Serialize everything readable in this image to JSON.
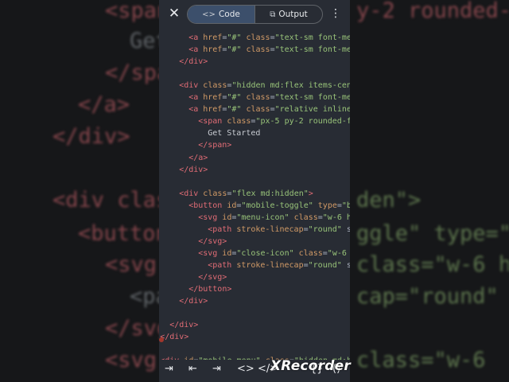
{
  "background": [
    {
      "cls": "t",
      "text": "<span"
    },
    {
      "cls": "p",
      "text": "Get"
    },
    {
      "cls": "t",
      "text": "</spa"
    },
    {
      "cls": "t",
      "text": "</a>"
    },
    {
      "cls": "t",
      "text": "</div>"
    },
    {
      "cls": "t",
      "text": "<div clas"
    },
    {
      "cls": "t",
      "text": "<button"
    },
    {
      "cls": "t",
      "text": "<svg"
    },
    {
      "cls": "p",
      "text": "<pa"
    },
    {
      "cls": "t",
      "text": "</svg"
    },
    {
      "cls": "t",
      "text": "<svg"
    },
    {
      "cls": "t",
      "text": "y-2 rounded-f"
    },
    {
      "cls": "s",
      "text": "den\">"
    },
    {
      "cls": "s",
      "text": "ggle\" type=\"b"
    },
    {
      "cls": "s",
      "text": "class=\"w-6 h"
    },
    {
      "cls": "s",
      "text": "cap=\"round\" s"
    },
    {
      "cls": "s",
      "text": "class=\"w-6"
    }
  ],
  "toolbar": {
    "close_icon": "close-icon",
    "tabs": [
      {
        "label": "Code",
        "icon": "<>",
        "active": true
      },
      {
        "label": "Output",
        "icon": "⧉",
        "active": false
      }
    ],
    "more_icon": "more-vert-icon"
  },
  "code_lines": [
    {
      "indent": 3,
      "segs": [
        [
          "t",
          "<a "
        ],
        [
          "a",
          "href"
        ],
        [
          "p",
          "="
        ],
        [
          "s",
          "\"#\""
        ],
        [
          "p",
          " "
        ],
        [
          "a",
          "class"
        ],
        [
          "p",
          "="
        ],
        [
          "s",
          "\"text-sm font-me"
        ]
      ]
    },
    {
      "indent": 3,
      "segs": [
        [
          "t",
          "<a "
        ],
        [
          "a",
          "href"
        ],
        [
          "p",
          "="
        ],
        [
          "s",
          "\"#\""
        ],
        [
          "p",
          " "
        ],
        [
          "a",
          "class"
        ],
        [
          "p",
          "="
        ],
        [
          "s",
          "\"text-sm font-me"
        ]
      ]
    },
    {
      "indent": 2,
      "segs": [
        [
          "t",
          "</div>"
        ]
      ]
    },
    {
      "indent": 0,
      "segs": []
    },
    {
      "indent": 2,
      "segs": [
        [
          "t",
          "<div "
        ],
        [
          "a",
          "class"
        ],
        [
          "p",
          "="
        ],
        [
          "s",
          "\"hidden md:flex items-cen"
        ]
      ]
    },
    {
      "indent": 3,
      "segs": [
        [
          "t",
          "<a "
        ],
        [
          "a",
          "href"
        ],
        [
          "p",
          "="
        ],
        [
          "s",
          "\"#\""
        ],
        [
          "p",
          " "
        ],
        [
          "a",
          "class"
        ],
        [
          "p",
          "="
        ],
        [
          "s",
          "\"text-sm font-me"
        ]
      ]
    },
    {
      "indent": 3,
      "segs": [
        [
          "t",
          "<a "
        ],
        [
          "a",
          "href"
        ],
        [
          "p",
          "="
        ],
        [
          "s",
          "\"#\""
        ],
        [
          "p",
          " "
        ],
        [
          "a",
          "class"
        ],
        [
          "p",
          "="
        ],
        [
          "s",
          "\"relative inline"
        ]
      ]
    },
    {
      "indent": 4,
      "segs": [
        [
          "t",
          "<span "
        ],
        [
          "a",
          "class"
        ],
        [
          "p",
          "="
        ],
        [
          "s",
          "\"px-5 py-2 rounded-f"
        ]
      ]
    },
    {
      "indent": 5,
      "segs": [
        [
          "x",
          "Get Started"
        ]
      ]
    },
    {
      "indent": 4,
      "segs": [
        [
          "t",
          "</span>"
        ]
      ]
    },
    {
      "indent": 3,
      "segs": [
        [
          "t",
          "</a>"
        ]
      ]
    },
    {
      "indent": 2,
      "segs": [
        [
          "t",
          "</div>"
        ]
      ]
    },
    {
      "indent": 0,
      "segs": []
    },
    {
      "indent": 2,
      "segs": [
        [
          "t",
          "<div "
        ],
        [
          "a",
          "class"
        ],
        [
          "p",
          "="
        ],
        [
          "s",
          "\"flex md:hidden\""
        ],
        [
          "t",
          ">"
        ]
      ]
    },
    {
      "indent": 3,
      "segs": [
        [
          "t",
          "<button "
        ],
        [
          "a",
          "id"
        ],
        [
          "p",
          "="
        ],
        [
          "s",
          "\"mobile-toggle\""
        ],
        [
          "p",
          " "
        ],
        [
          "a",
          "type"
        ],
        [
          "p",
          "="
        ],
        [
          "s",
          "\"b"
        ]
      ]
    },
    {
      "indent": 4,
      "segs": [
        [
          "t",
          "<svg "
        ],
        [
          "a",
          "id"
        ],
        [
          "p",
          "="
        ],
        [
          "s",
          "\"menu-icon\""
        ],
        [
          "p",
          " "
        ],
        [
          "a",
          "class"
        ],
        [
          "p",
          "="
        ],
        [
          "s",
          "\"w-6 h"
        ]
      ]
    },
    {
      "indent": 5,
      "segs": [
        [
          "t",
          "<path "
        ],
        [
          "a",
          "stroke-linecap"
        ],
        [
          "p",
          "="
        ],
        [
          "s",
          "\"round\""
        ],
        [
          "p",
          " s"
        ]
      ]
    },
    {
      "indent": 4,
      "segs": [
        [
          "t",
          "</svg>"
        ]
      ]
    },
    {
      "indent": 4,
      "segs": [
        [
          "t",
          "<svg "
        ],
        [
          "a",
          "id"
        ],
        [
          "p",
          "="
        ],
        [
          "s",
          "\"close-icon\""
        ],
        [
          "p",
          " "
        ],
        [
          "a",
          "class"
        ],
        [
          "p",
          "="
        ],
        [
          "s",
          "\"w-6"
        ]
      ]
    },
    {
      "indent": 5,
      "segs": [
        [
          "t",
          "<path "
        ],
        [
          "a",
          "stroke-linecap"
        ],
        [
          "p",
          "="
        ],
        [
          "s",
          "\"round\""
        ],
        [
          "p",
          " s"
        ]
      ]
    },
    {
      "indent": 4,
      "segs": [
        [
          "t",
          "</svg>"
        ]
      ]
    },
    {
      "indent": 3,
      "segs": [
        [
          "t",
          "</button>"
        ]
      ]
    },
    {
      "indent": 2,
      "segs": [
        [
          "t",
          "</div>"
        ]
      ]
    },
    {
      "indent": 0,
      "segs": []
    },
    {
      "indent": 1,
      "segs": [
        [
          "t",
          "</div>"
        ]
      ]
    },
    {
      "indent": 0,
      "segs": [
        [
          "t",
          "</div>"
        ]
      ]
    },
    {
      "indent": 0,
      "segs": []
    },
    {
      "indent": 0,
      "segs": [
        [
          "t",
          "<div "
        ],
        [
          "a",
          "id"
        ],
        [
          "p",
          "="
        ],
        [
          "s",
          "\"mobile-menu\""
        ],
        [
          "p",
          " "
        ],
        [
          "a",
          "class"
        ],
        [
          "p",
          "="
        ],
        [
          "s",
          "\"hidden md:h"
        ]
      ]
    }
  ],
  "bottom_keys": [
    {
      "name": "tab-key",
      "glyph": "⇥"
    },
    {
      "name": "arrow-left-key",
      "glyph": "⇤"
    },
    {
      "name": "arrow-right-key",
      "glyph": "⇥"
    },
    {
      "name": "angle-brackets-key",
      "glyph": "<>"
    },
    {
      "name": "close-tag-key",
      "glyph": "</>"
    },
    {
      "name": "braces-key",
      "glyph": "{}"
    },
    {
      "name": "parens-key",
      "glyph": "()"
    }
  ],
  "watermark": "XRecorder"
}
